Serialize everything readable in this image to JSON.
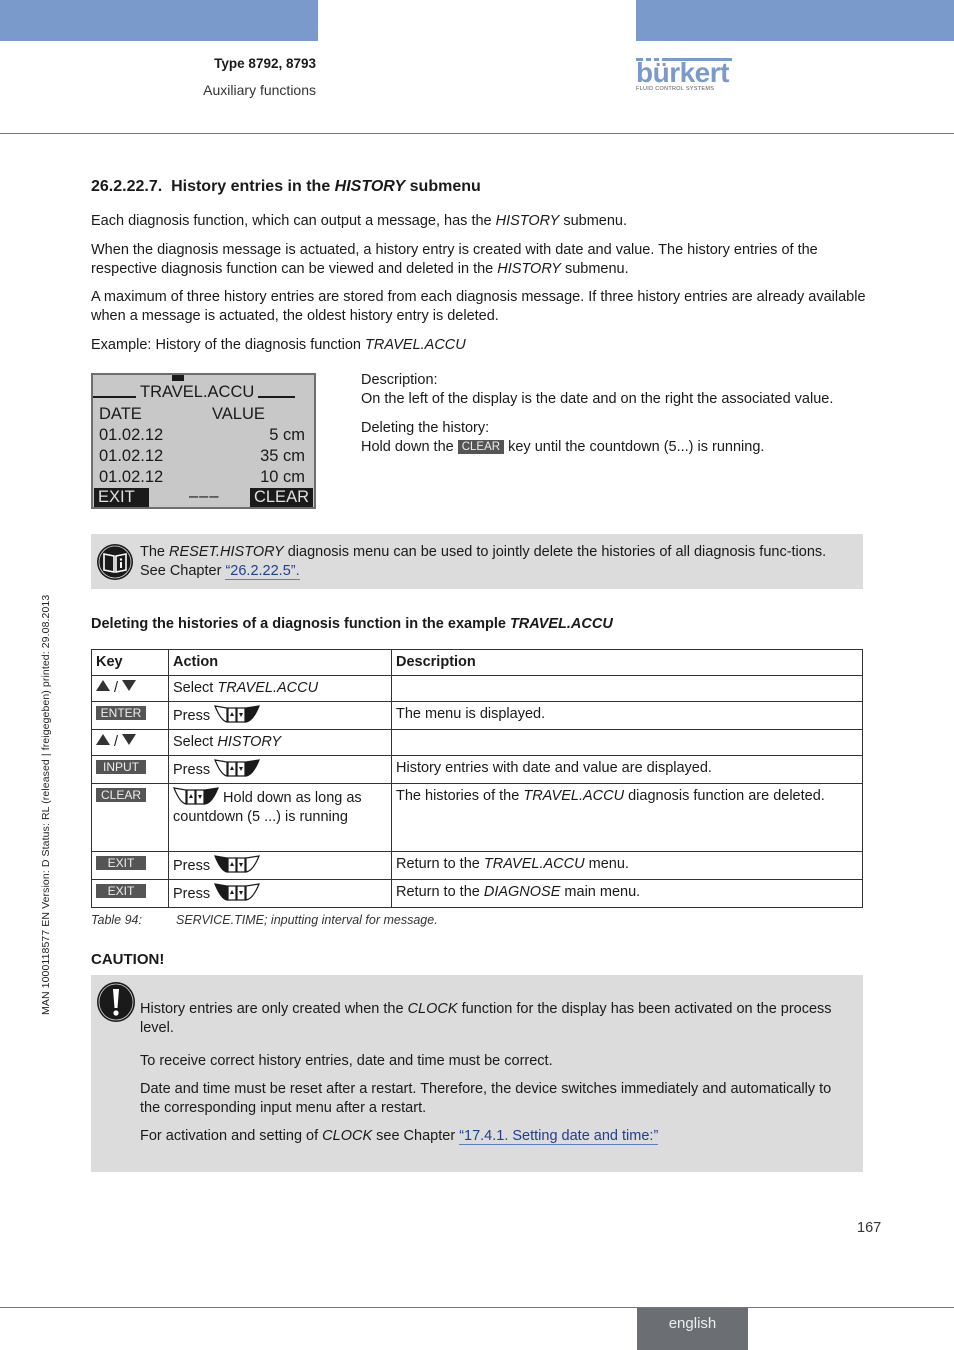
{
  "header": {
    "type_label": "Type 8792, 8793",
    "section_label": "Auxiliary functions",
    "logo_word": "bürkert",
    "logo_tagline": "FLUID CONTROL SYSTEMS",
    "brand_color": "#7a9acb"
  },
  "side_info": "MAN  1000118577  EN  Version: D  Status: RL (released | freigegeben)  printed: 29.08.2013",
  "section": {
    "number": "26.2.22.7.",
    "title_pre": "History entries in the ",
    "title_italic": "HISTORY",
    "title_post": " submenu"
  },
  "paragraphs": {
    "p1_pre": "Each diagnosis function, which can output a message, has the ",
    "p1_italic": "HISTORY",
    "p1_post": " submenu.",
    "p2_pre": "When the diagnosis message is actuated, a history entry is created with date and value. The history entries of the respective diagnosis function can be viewed and deleted in the ",
    "p2_italic": "HISTORY",
    "p2_post": " submenu.",
    "p3": "A maximum of three history entries are stored from each diagnosis message. If three history entries are already available when a message is actuated, the oldest history entry is deleted.",
    "p4_pre": "Example: History of the diagnosis function ",
    "p4_italic": "TRAVEL.ACCU"
  },
  "lcd": {
    "title": "TRAVEL.ACCU",
    "col_date": "DATE",
    "col_value": "VALUE",
    "entries": [
      {
        "date": "01.02.12",
        "value": "5 cm"
      },
      {
        "date": "01.02.12",
        "value": "35 cm"
      },
      {
        "date": "01.02.12",
        "value": "10 cm"
      }
    ],
    "left_softkey": "EXIT",
    "middle": "–––",
    "right_softkey": "CLEAR"
  },
  "description": {
    "label": "Description:",
    "text": "On the left of the display is the date and on the right the associated value.",
    "delete_label": "Deleting the history:",
    "delete_pre": "Hold down the ",
    "delete_key": "CLEAR",
    "delete_post": " key until the countdown (5...) is running."
  },
  "note": {
    "pre": "The ",
    "italic": "RESET.HISTORY",
    "mid": " diagnosis menu can be used to jointly delete the histories of all diagnosis func-tions. See Chapter ",
    "link": "“26.2.22.5”."
  },
  "table": {
    "heading_pre": "Deleting the histories of a diagnosis function in the example ",
    "heading_italic": "TRAVEL.ACCU",
    "headers": [
      "Key",
      "Action",
      "Description"
    ],
    "rows": [
      {
        "key_type": "arrows",
        "key": "/",
        "action_pre": "Select ",
        "action_italic": "TRAVEL.ACCU",
        "action_post": "",
        "button": "",
        "desc_pre": "",
        "desc_italic": "",
        "desc_post": ""
      },
      {
        "key_type": "chip",
        "key": "ENTER",
        "action_pre": "Press ",
        "action_italic": "",
        "action_post": "",
        "button": "right",
        "desc_pre": "The menu is displayed.",
        "desc_italic": "",
        "desc_post": ""
      },
      {
        "key_type": "arrows",
        "key": "/",
        "action_pre": "Select ",
        "action_italic": "HISTORY",
        "action_post": "",
        "button": "",
        "desc_pre": "",
        "desc_italic": "",
        "desc_post": ""
      },
      {
        "key_type": "chip",
        "key": "INPUT",
        "action_pre": "Press ",
        "action_italic": "",
        "action_post": "",
        "button": "right",
        "desc_pre": "History entries with date and value are displayed.",
        "desc_italic": "",
        "desc_post": ""
      },
      {
        "key_type": "chip",
        "key": "CLEAR",
        "action_pre": "",
        "action_italic": "",
        "action_post": " Hold down as long as countdown (5 ...) is running",
        "button": "right",
        "desc_pre": "The histories of the ",
        "desc_italic": "TRAVEL.ACCU",
        "desc_post": " diagnosis function are deleted."
      },
      {
        "key_type": "chip",
        "key": "EXIT",
        "action_pre": "Press ",
        "action_italic": "",
        "action_post": "",
        "button": "left",
        "desc_pre": "Return to the ",
        "desc_italic": "TRAVEL.ACCU",
        "desc_post": " menu."
      },
      {
        "key_type": "chip",
        "key": "EXIT",
        "action_pre": "Press ",
        "action_italic": "",
        "action_post": "",
        "button": "left",
        "desc_pre": "Return to the ",
        "desc_italic": "DIAGNOSE",
        "desc_post": " main menu."
      }
    ],
    "caption_label": "Table 94:",
    "caption_text": "SERVICE.TIME; inputting interval for message."
  },
  "caution": {
    "heading": "CAUTION!",
    "p1_pre": "History entries are only created when the ",
    "p1_italic": "CLOCK",
    "p1_post": " function for the display has been activated on the process level.",
    "p2": "To receive correct history entries, date and time must be correct.",
    "p3": "Date and time must be reset after a restart. Therefore, the device switches immediately and automatically to the corresponding input menu after a restart.",
    "p4_pre": "For activation and setting of ",
    "p4_italic": "CLOCK",
    "p4_mid": " see Chapter ",
    "p4_link": "“17.4.1. Setting date and time:”"
  },
  "footer": {
    "page_number": "167",
    "language": "english"
  }
}
